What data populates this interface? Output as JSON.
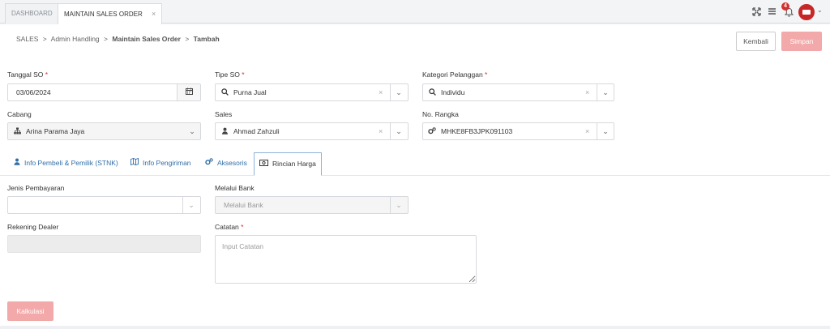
{
  "tabs": [
    {
      "label": "DASHBOARD"
    },
    {
      "label": "MAINTAIN SALES ORDER",
      "close": "×"
    }
  ],
  "topbar": {
    "notification_count": "4"
  },
  "breadcrumb": {
    "items": [
      "SALES",
      "Admin Handling",
      "Maintain Sales Order",
      "Tambah"
    ],
    "sep": ">"
  },
  "actions": {
    "back_label": "Kembali",
    "save_label": "Simpan"
  },
  "form": {
    "tanggal_so": {
      "label": "Tanggal SO",
      "value": "03/06/2024"
    },
    "tipe_so": {
      "label": "Tipe SO",
      "value": "Purna Jual"
    },
    "kategori_pelanggan": {
      "label": "Kategori Pelanggan",
      "value": "Individu"
    },
    "cabang": {
      "label": "Cabang",
      "value": "Arina Parama Jaya"
    },
    "sales": {
      "label": "Sales",
      "value": "Ahmad Zahzuli"
    },
    "no_rangka": {
      "label": "No. Rangka",
      "value": "MHKE8FB3JPK091103"
    },
    "required_mark": "*"
  },
  "section_tabs": [
    {
      "label": "Info Pembeli & Pemilik (STNK)",
      "icon": "user-icon"
    },
    {
      "label": "Info Pengiriman",
      "icon": "map-icon"
    },
    {
      "label": "Aksesoris",
      "icon": "cogs-icon"
    },
    {
      "label": "Rincian Harga",
      "icon": "money-icon",
      "active": true
    }
  ],
  "rincian": {
    "jenis_pembayaran": {
      "label": "Jenis Pembayaran",
      "value": ""
    },
    "melalui_bank": {
      "label": "Melalui Bank",
      "placeholder": "Melalui Bank"
    },
    "rekening_dealer": {
      "label": "Rekening Dealer",
      "value": ""
    },
    "catatan": {
      "label": "Catatan",
      "placeholder": "Input Catatan"
    }
  },
  "calc_label": "Kalkulasi",
  "colors": {
    "accent": "#2f6ea8",
    "danger_light": "#f3a9a9",
    "required": "#d32f2f",
    "avatar": "#c62828"
  }
}
